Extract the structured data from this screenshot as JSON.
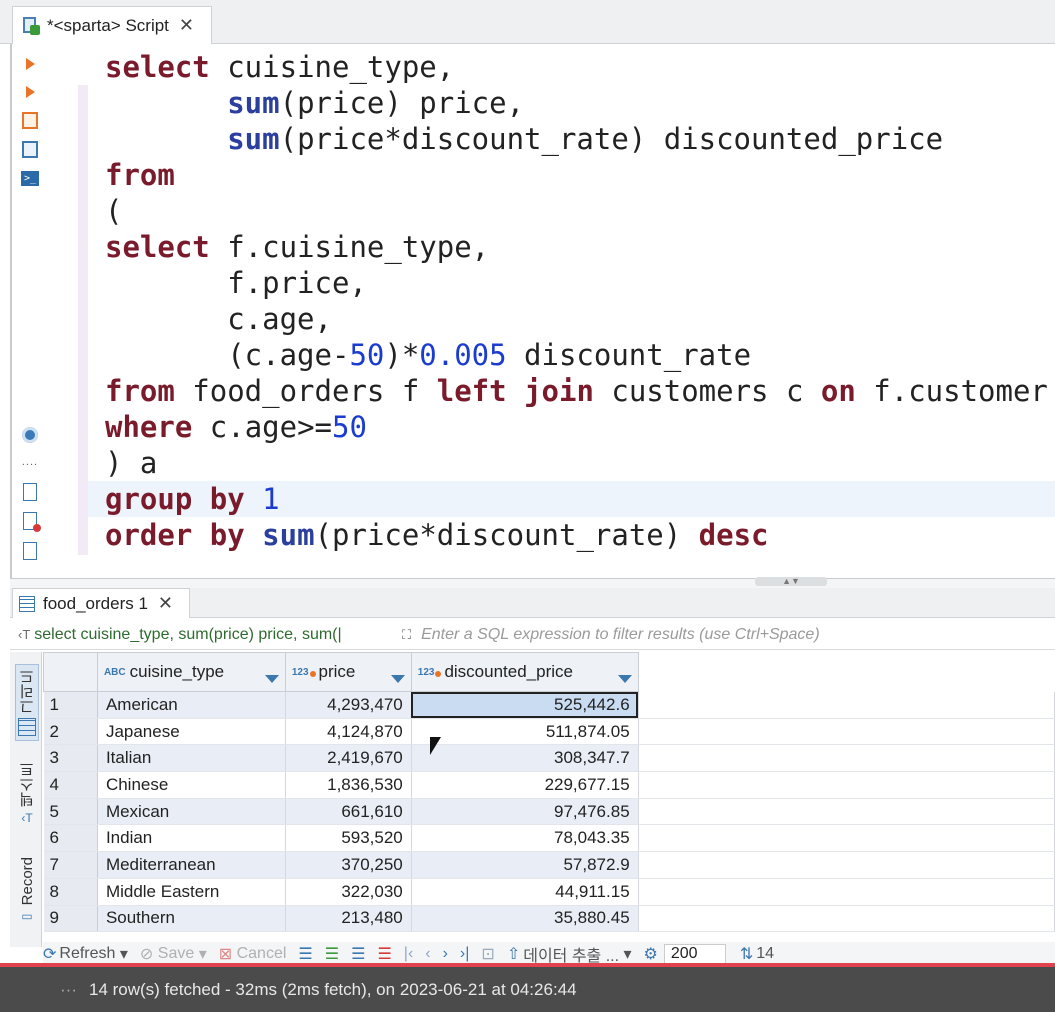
{
  "editor": {
    "tab_title": "*<sparta> Script",
    "close_glyph": "✕",
    "lines": [
      [
        {
          "t": "select",
          "c": "kw"
        },
        {
          "t": " cuisine_type,"
        }
      ],
      [
        {
          "t": "       "
        },
        {
          "t": "sum",
          "c": "fn"
        },
        {
          "t": "(price) price,"
        }
      ],
      [
        {
          "t": "       "
        },
        {
          "t": "sum",
          "c": "fn"
        },
        {
          "t": "(price*discount_rate) discounted_price"
        }
      ],
      [
        {
          "t": "from",
          "c": "kw"
        }
      ],
      [
        {
          "t": "("
        }
      ],
      [
        {
          "t": "select",
          "c": "kw"
        },
        {
          "t": " f.cuisine_type,"
        }
      ],
      [
        {
          "t": "       f.price,"
        }
      ],
      [
        {
          "t": "       c.age,"
        }
      ],
      [
        {
          "t": "       (c.age-"
        },
        {
          "t": "50",
          "c": "num"
        },
        {
          "t": ")*"
        },
        {
          "t": "0.005",
          "c": "num"
        },
        {
          "t": " discount_rate"
        }
      ],
      [
        {
          "t": "from",
          "c": "kw"
        },
        {
          "t": " food_orders f "
        },
        {
          "t": "left",
          "c": "kw"
        },
        {
          "t": " "
        },
        {
          "t": "join",
          "c": "kw"
        },
        {
          "t": " customers c "
        },
        {
          "t": "on",
          "c": "kw"
        },
        {
          "t": " f.customer"
        }
      ],
      [
        {
          "t": "where",
          "c": "kw"
        },
        {
          "t": " c.age>="
        },
        {
          "t": "50",
          "c": "num"
        }
      ],
      [
        {
          "t": ") a"
        }
      ],
      [
        {
          "t": "group",
          "c": "kw"
        },
        {
          "t": " "
        },
        {
          "t": "by",
          "c": "kw"
        },
        {
          "t": " "
        },
        {
          "t": "1",
          "c": "num"
        }
      ],
      [
        {
          "t": "order",
          "c": "kw"
        },
        {
          "t": " "
        },
        {
          "t": "by",
          "c": "kw"
        },
        {
          "t": " "
        },
        {
          "t": "sum",
          "c": "fn"
        },
        {
          "t": "(price*discount_rate) "
        },
        {
          "t": "desc",
          "c": "kw"
        }
      ]
    ]
  },
  "results": {
    "tab_title": "food_orders 1",
    "close_glyph": "✕",
    "filter_query": "select cuisine_type, sum(price) price, sum(|",
    "filter_placeholder": "Enter a SQL expression to filter results (use Ctrl+Space)",
    "side_tabs": {
      "grid": "그리드",
      "text": "텍스트",
      "record": "Record"
    },
    "columns": [
      {
        "type_badge": "ABC",
        "label": "cuisine_type"
      },
      {
        "type_badge": "123",
        "label": "price"
      },
      {
        "type_badge": "123",
        "label": "discounted_price"
      }
    ],
    "rows": [
      {
        "n": "1",
        "cuisine": "American",
        "price": "4,293,470",
        "discounted": "525,442.6"
      },
      {
        "n": "2",
        "cuisine": "Japanese",
        "price": "4,124,870",
        "discounted": "511,874.05"
      },
      {
        "n": "3",
        "cuisine": "Italian",
        "price": "2,419,670",
        "discounted": "308,347.7"
      },
      {
        "n": "4",
        "cuisine": "Chinese",
        "price": "1,836,530",
        "discounted": "229,677.15"
      },
      {
        "n": "5",
        "cuisine": "Mexican",
        "price": "661,610",
        "discounted": "97,476.85"
      },
      {
        "n": "6",
        "cuisine": "Indian",
        "price": "593,520",
        "discounted": "78,043.35"
      },
      {
        "n": "7",
        "cuisine": "Mediterranean",
        "price": "370,250",
        "discounted": "57,872.9"
      },
      {
        "n": "8",
        "cuisine": "Middle Eastern",
        "price": "322,030",
        "discounted": "44,911.15"
      },
      {
        "n": "9",
        "cuisine": "Southern",
        "price": "213,480",
        "discounted": "35,880.45"
      }
    ],
    "selected_row": 0,
    "toolbar": {
      "refresh": "Refresh",
      "save": "Save",
      "cancel": "Cancel",
      "export": "데이터 추출 ...",
      "fetch_size": "200",
      "row_count": "14"
    }
  },
  "status": {
    "dots": "···",
    "text": "14 row(s) fetched - 32ms (2ms fetch), on 2023-06-21 at 04:26:44"
  }
}
